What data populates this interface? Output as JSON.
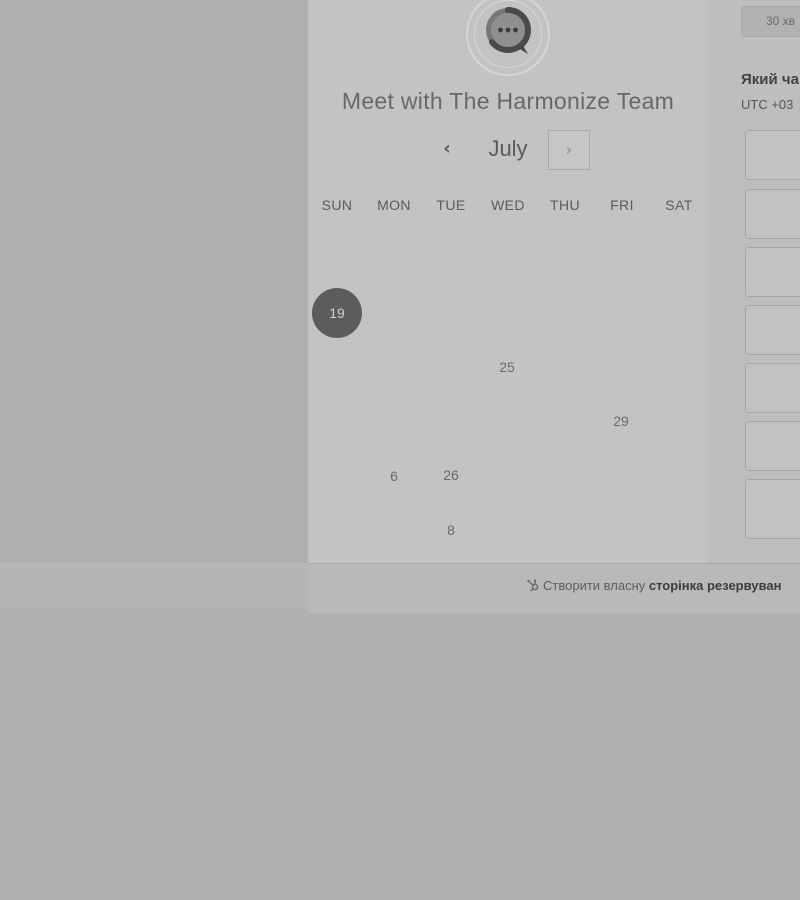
{
  "meeting": {
    "title": "Meet with The Harmonize Team",
    "avatar_icon": "chat-bubble-icon"
  },
  "calendar": {
    "month": "July",
    "prev_label": "‹",
    "next_label": "›",
    "weekdays": [
      "SUN",
      "MON",
      "TUE",
      "WED",
      "THU",
      "FRI",
      "SAT"
    ],
    "days": [
      {
        "label": "19",
        "selected": true
      },
      {
        "label": "25",
        "selected": false
      },
      {
        "label": "29",
        "selected": false
      },
      {
        "label": "6",
        "selected": false
      },
      {
        "label": "26",
        "selected": false
      },
      {
        "label": "8",
        "selected": false
      }
    ]
  },
  "booking": {
    "duration_label": "30 хв",
    "time_question": "Який ча",
    "timezone": "UTC +03"
  },
  "footer": {
    "prefix": "Створити власну ",
    "bold": "сторінка резервуван"
  }
}
